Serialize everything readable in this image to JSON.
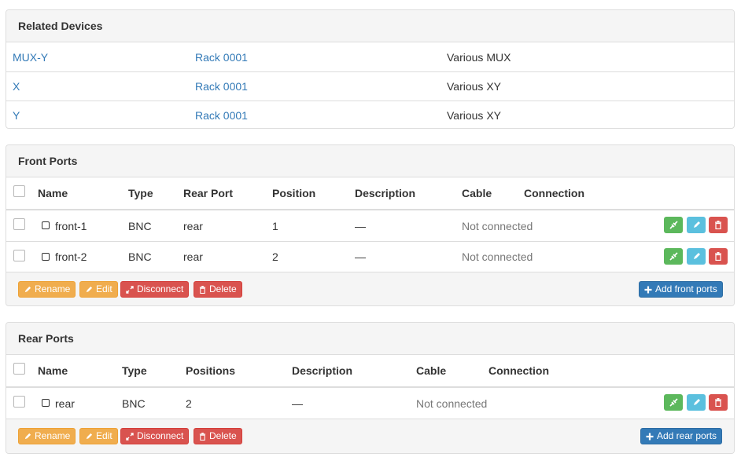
{
  "related_devices": {
    "title": "Related Devices",
    "rows": [
      {
        "name": "MUX-Y",
        "rack": "Rack 0001",
        "type": "Various MUX"
      },
      {
        "name": "X",
        "rack": "Rack 0001",
        "type": "Various XY"
      },
      {
        "name": "Y",
        "rack": "Rack 0001",
        "type": "Various XY"
      }
    ]
  },
  "front_ports": {
    "title": "Front Ports",
    "headers": {
      "name": "Name",
      "type": "Type",
      "rear_port": "Rear Port",
      "position": "Position",
      "description": "Description",
      "cable": "Cable",
      "connection": "Connection"
    },
    "rows": [
      {
        "name": "front-1",
        "type": "BNC",
        "rear_port": "rear",
        "position": "1",
        "description": "—",
        "cable": "Not connected"
      },
      {
        "name": "front-2",
        "type": "BNC",
        "rear_port": "rear",
        "position": "2",
        "description": "—",
        "cable": "Not connected"
      }
    ],
    "actions": {
      "rename": "Rename",
      "edit": "Edit",
      "disconnect": "Disconnect",
      "delete": "Delete",
      "add": "Add front ports"
    }
  },
  "rear_ports": {
    "title": "Rear Ports",
    "headers": {
      "name": "Name",
      "type": "Type",
      "positions": "Positions",
      "description": "Description",
      "cable": "Cable",
      "connection": "Connection"
    },
    "rows": [
      {
        "name": "rear",
        "type": "BNC",
        "positions": "2",
        "description": "—",
        "cable": "Not connected"
      }
    ],
    "actions": {
      "rename": "Rename",
      "edit": "Edit",
      "disconnect": "Disconnect",
      "delete": "Delete",
      "add": "Add rear ports"
    }
  },
  "colors": {
    "link": "#337ab7",
    "warning": "#f0ad4e",
    "danger": "#d9534f",
    "primary": "#337ab7",
    "success": "#5cb85c",
    "info": "#5bc0de"
  },
  "icons": [
    "pencil-icon",
    "disconnect-icon",
    "trash-icon",
    "plus-icon",
    "connect-icon",
    "port-icon"
  ]
}
